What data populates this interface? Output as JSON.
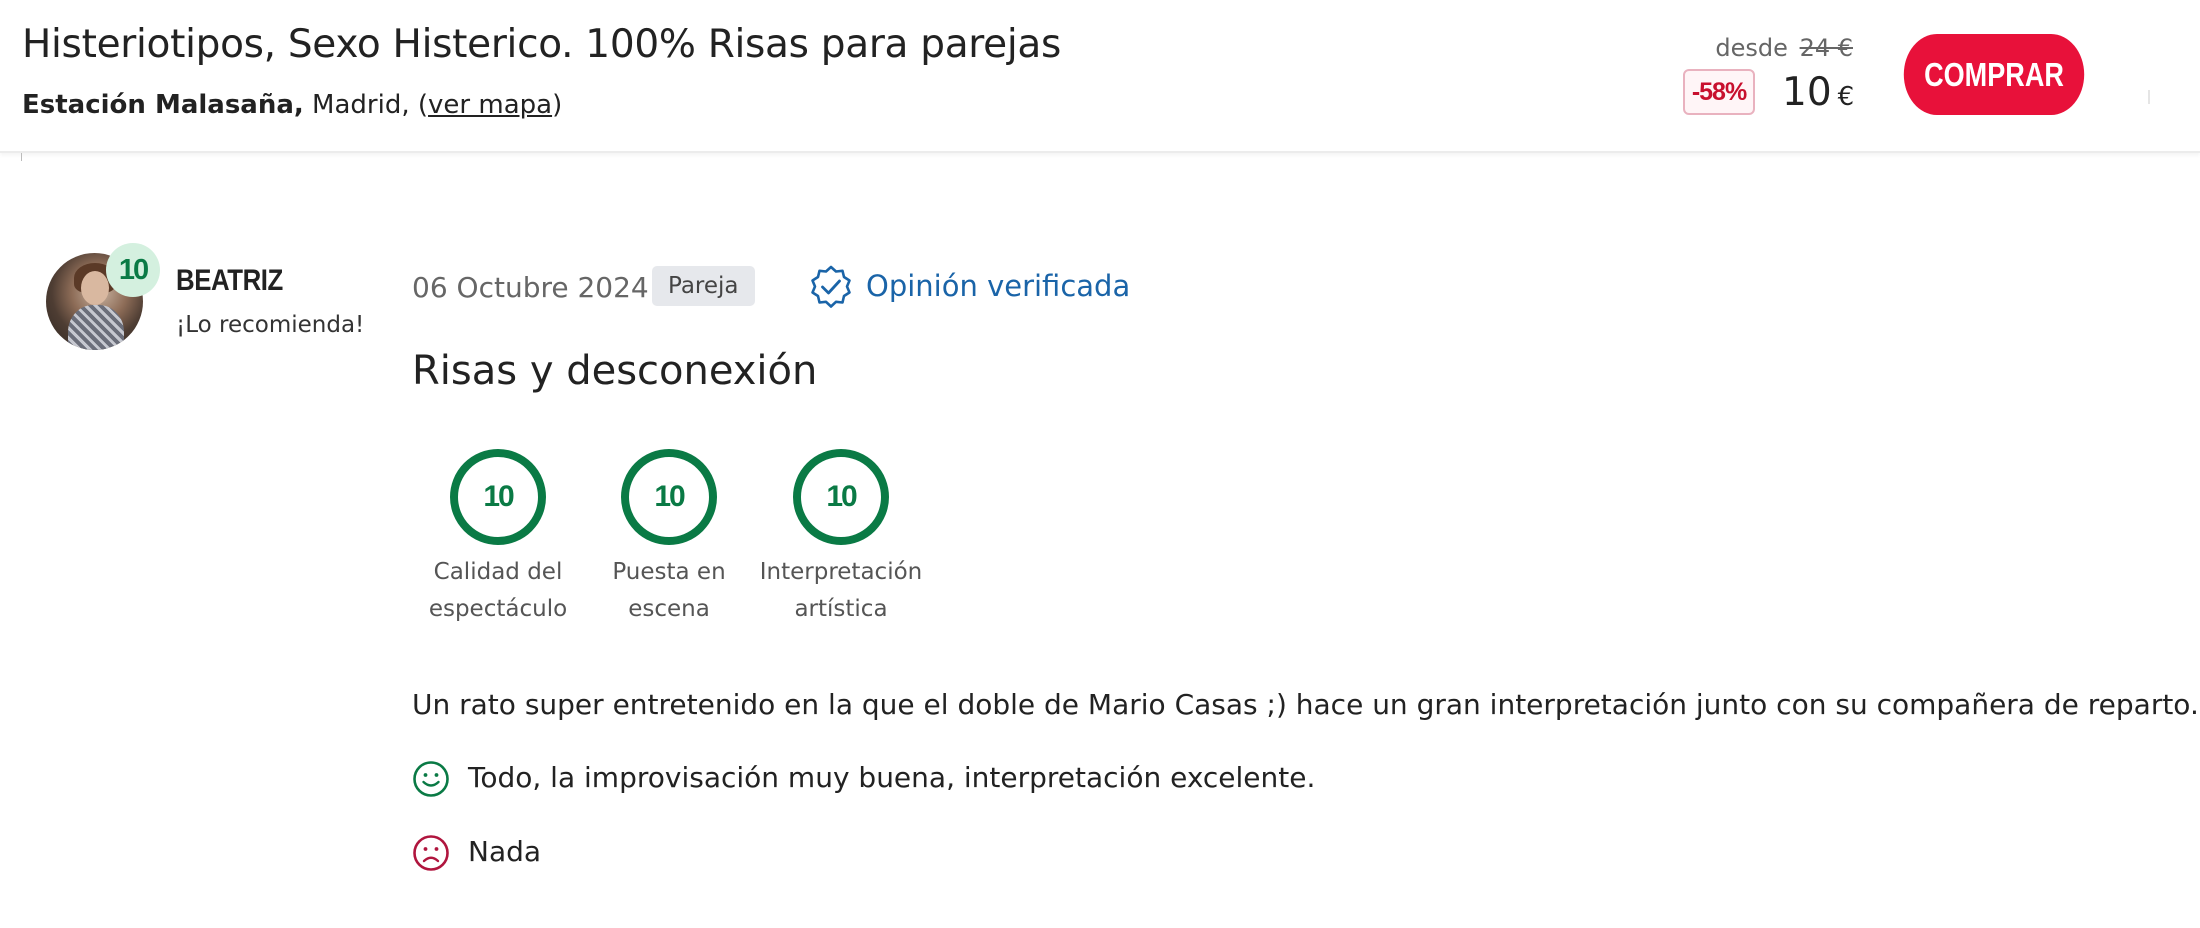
{
  "header": {
    "title": "Histeriotipos, Sexo Histerico. 100% Risas para parejas",
    "venue": "Estación Malasaña,",
    "city": " Madrid, (",
    "map_link": "ver mapa",
    "map_close": ")",
    "from_label": "desde",
    "old_price": "24 €",
    "discount": "-58%",
    "price": "10",
    "currency": "€",
    "buy_label": "COMPRAR"
  },
  "review": {
    "user": {
      "name": "BEATRIZ",
      "score": "10",
      "recommendation": "¡Lo recomienda!"
    },
    "date": "06 Octubre 2024",
    "tag": "Pareja",
    "verified_label": "Opinión verificada",
    "title": "Risas y desconexión",
    "ratings": [
      {
        "score": "10",
        "label_line1": "Calidad del",
        "label_line2": "espectáculo"
      },
      {
        "score": "10",
        "label_line1": "Puesta en",
        "label_line2": "escena"
      },
      {
        "score": "10",
        "label_line1": "Interpretación",
        "label_line2": "artística"
      }
    ],
    "comment": "Un rato super entretenido en la que el doble de Mario Casas ;) hace un gran interpretación junto con su compañera de reparto.",
    "positive": "Todo, la improvisación muy buena, interpretación excelente.",
    "negative": "Nada"
  },
  "icons": {
    "verified": "verified-badge-icon",
    "positive": "smile-icon",
    "negative": "frown-icon"
  },
  "colors": {
    "brand_red": "#e8113a",
    "score_green": "#0a7a45",
    "verified_blue": "#1a64a8",
    "negative_red": "#b0153e"
  }
}
